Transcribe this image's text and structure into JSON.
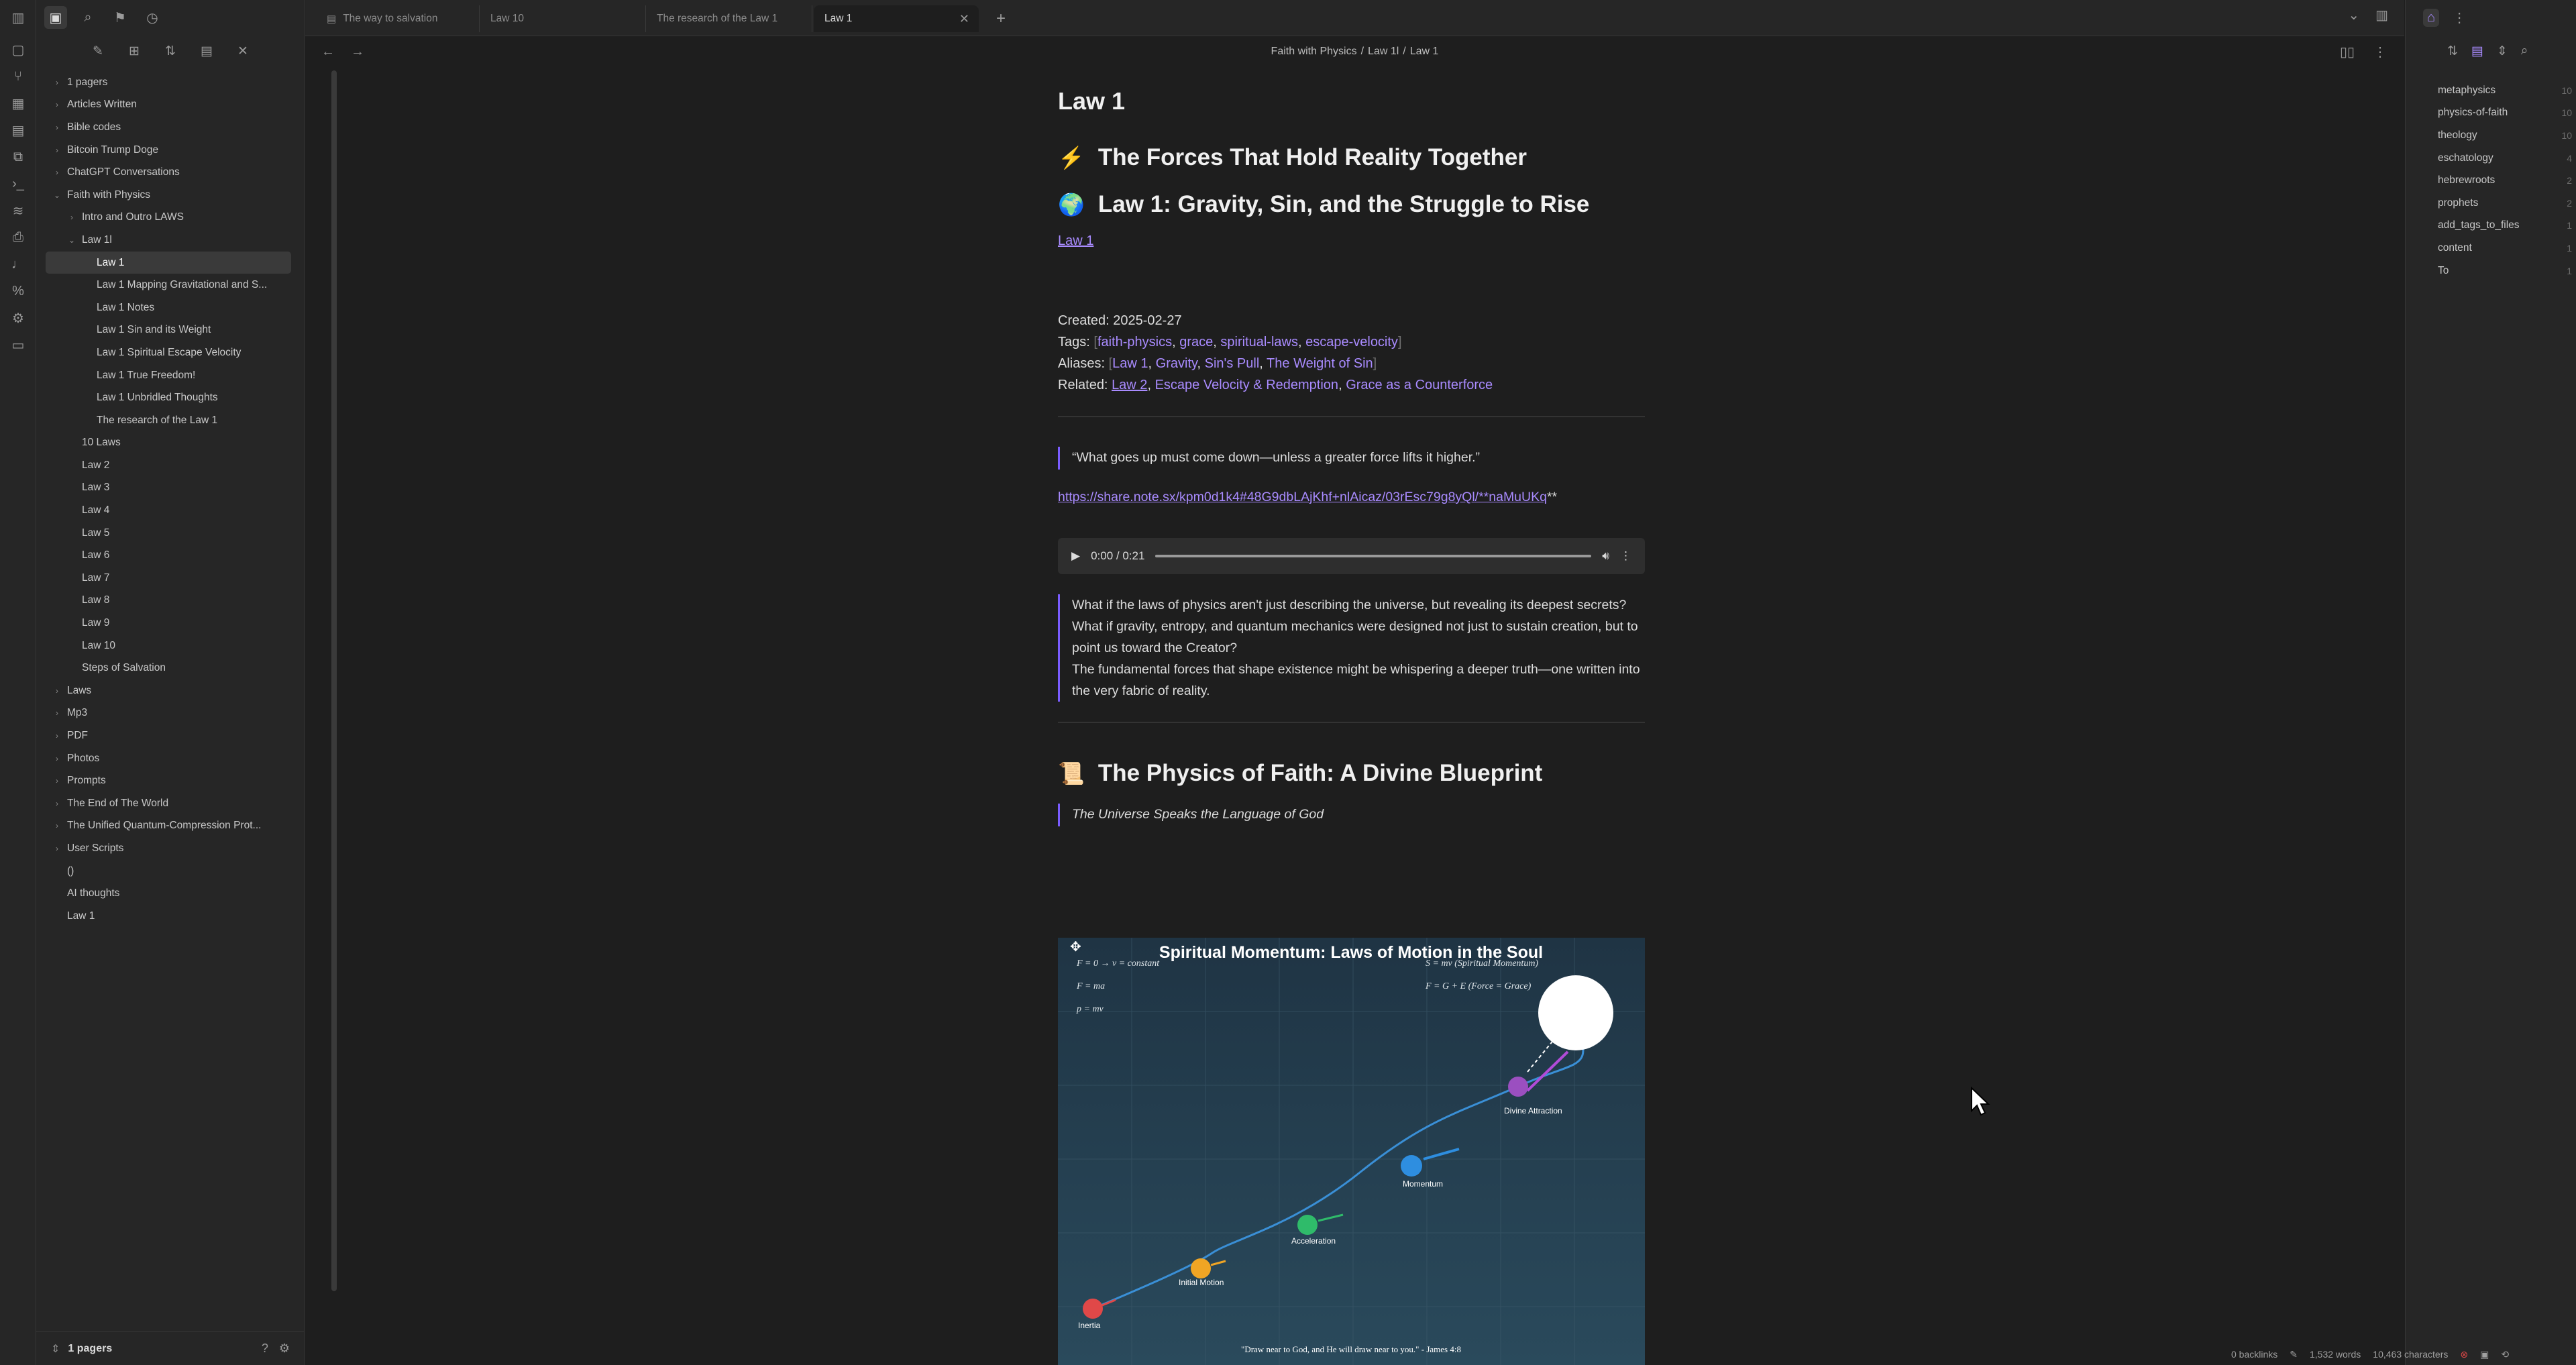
{
  "tabs": [
    {
      "label": "The way to salvation",
      "icon": "document-icon"
    },
    {
      "label": "Law 10"
    },
    {
      "label": "The research of the Law 1"
    },
    {
      "label": "Law 1",
      "active": true
    }
  ],
  "breadcrumb": [
    "Faith with Physics",
    "Law 1l",
    "Law 1"
  ],
  "tree": [
    {
      "label": "1 pagers",
      "depth": 0,
      "chev": "›"
    },
    {
      "label": "Articles Written",
      "depth": 0,
      "chev": "›"
    },
    {
      "label": "Bible codes",
      "depth": 0,
      "chev": "›"
    },
    {
      "label": "Bitcoin Trump Doge",
      "depth": 0,
      "chev": "›"
    },
    {
      "label": "ChatGPT Conversations",
      "depth": 0,
      "chev": "›"
    },
    {
      "label": "Faith with Physics",
      "depth": 0,
      "chev": "⌄"
    },
    {
      "label": "Intro and Outro  LAWS",
      "depth": 1,
      "chev": "›"
    },
    {
      "label": "Law 1l",
      "depth": 1,
      "chev": "⌄"
    },
    {
      "label": "Law 1",
      "depth": 2,
      "selected": true
    },
    {
      "label": "Law 1 Mapping Gravitational and S...",
      "depth": 2
    },
    {
      "label": "Law 1 Notes",
      "depth": 2
    },
    {
      "label": "Law 1 Sin and its Weight",
      "depth": 2
    },
    {
      "label": "Law 1 Spiritual Escape Velocity",
      "depth": 2
    },
    {
      "label": "Law 1 True Freedom!",
      "depth": 2
    },
    {
      "label": "Law 1 Unbridled Thoughts",
      "depth": 2
    },
    {
      "label": "The research of the Law 1",
      "depth": 2
    },
    {
      "label": "10 Laws",
      "depth": 1
    },
    {
      "label": "Law 2",
      "depth": 1
    },
    {
      "label": "Law 3",
      "depth": 1
    },
    {
      "label": "Law 4",
      "depth": 1
    },
    {
      "label": "Law 5",
      "depth": 1
    },
    {
      "label": "Law 6",
      "depth": 1
    },
    {
      "label": "Law 7",
      "depth": 1
    },
    {
      "label": "Law 8",
      "depth": 1
    },
    {
      "label": "Law 9",
      "depth": 1
    },
    {
      "label": "Law 10",
      "depth": 1
    },
    {
      "label": "Steps of Salvation",
      "depth": 1
    },
    {
      "label": "Laws",
      "depth": 0,
      "chev": "›"
    },
    {
      "label": "Mp3",
      "depth": 0,
      "chev": "›"
    },
    {
      "label": "PDF",
      "depth": 0,
      "chev": "›"
    },
    {
      "label": "Photos",
      "depth": 0,
      "chev": "›"
    },
    {
      "label": "Prompts",
      "depth": 0,
      "chev": "›"
    },
    {
      "label": "The End of The World",
      "depth": 0,
      "chev": "›"
    },
    {
      "label": "The Unified Quantum-Compression Prot...",
      "depth": 0,
      "chev": "›"
    },
    {
      "label": "User Scripts",
      "depth": 0,
      "chev": "›"
    },
    {
      "label": "()",
      "depth": 0
    },
    {
      "label": "AI thoughts",
      "depth": 0
    },
    {
      "label": "Law 1",
      "depth": 0
    }
  ],
  "vault_name": "1 pagers",
  "note": {
    "title": "Law 1",
    "h1a": "The Forces That Hold Reality Together",
    "h1a_icon": "⚡",
    "h1b": "Law 1: Gravity, Sin, and the Struggle to Rise",
    "h1b_icon": "🌍",
    "link_law1": "Law 1",
    "created_label": "Created:",
    "created": "2025-02-27",
    "tags_label": "Tags:",
    "tags": [
      "faith-physics",
      "grace",
      "spiritual-laws",
      "escape-velocity"
    ],
    "aliases_label": "Aliases:",
    "aliases": [
      "Law 1",
      "Gravity",
      "Sin's Pull",
      "The Weight of Sin"
    ],
    "related_label": "Related:",
    "related_link": "Law 2",
    "related": [
      "Escape Velocity & Redemption",
      "Grace as a Counterforce"
    ],
    "quote": "“What goes up must come down—unless a greater force lifts it higher.”",
    "url": "https://share.note.sx/kpm0d1k4#48G9dbLAjKhf+nlAicaz/03rEsc79g8yQl/**naMuUKq",
    "url_suffix": "**",
    "audio_time": "0:00 / 0:21",
    "callout": [
      "What if the laws of physics aren't just describing the universe, but revealing its deepest secrets?",
      "What if gravity, entropy, and quantum mechanics were designed not just to sustain creation, but to point us toward the Creator?",
      "The fundamental forces that shape existence might be whispering a deeper truth—one written into the very fabric of reality."
    ],
    "h1c": "The Physics of Faith: A Divine Blueprint",
    "h1c_icon": "📜",
    "subtitle": "The Universe Speaks the Language of God",
    "image": {
      "title": "Spiritual Momentum: Laws of Motion in the Soul",
      "formulas_left": [
        "F = 0 → v = constant",
        "F = ma",
        "p = mv"
      ],
      "formulas_right": [
        "S = mv (Spiritual Momentum)",
        "F = G + E (Force = Grace)"
      ],
      "labels": [
        "Inertia",
        "Initial Motion",
        "Acceleration",
        "Momentum",
        "Divine Attraction"
      ],
      "verse": "\"Draw near to God, and He will draw near to you.\" - James 4:8"
    }
  },
  "tag_pane": [
    {
      "tag": "metaphysics",
      "count": "10"
    },
    {
      "tag": "physics-of-faith",
      "count": "10"
    },
    {
      "tag": "theology",
      "count": "10"
    },
    {
      "tag": "eschatology",
      "count": "4"
    },
    {
      "tag": "hebrewroots",
      "count": "2"
    },
    {
      "tag": "prophets",
      "count": "2"
    },
    {
      "tag": "add_tags_to_files",
      "count": "1"
    },
    {
      "tag": "content",
      "count": "1"
    },
    {
      "tag": "To",
      "count": "1"
    }
  ],
  "status": {
    "backlinks": "0 backlinks",
    "words": "1,532 words",
    "chars": "10,463 characters"
  },
  "colors": {
    "accent": "#a98bff",
    "bg": "#1e1e1e",
    "panel": "#262626"
  }
}
